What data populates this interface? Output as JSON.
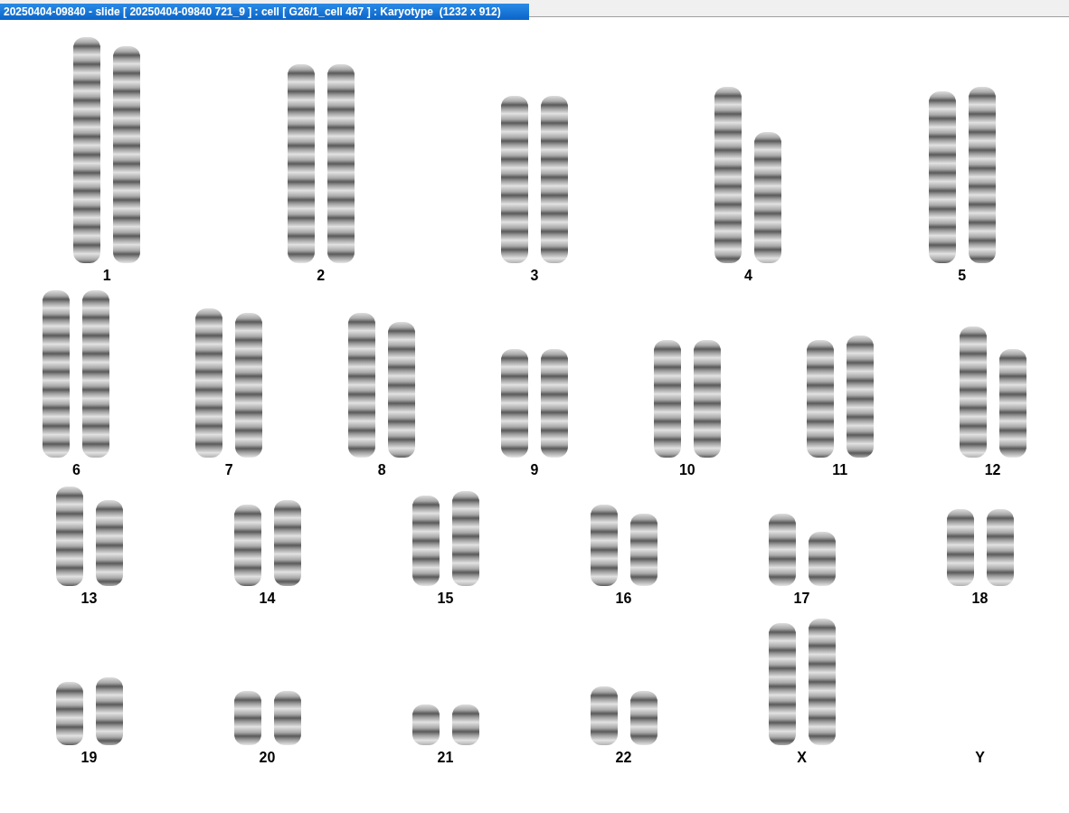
{
  "window": {
    "title": "20250404-09840 - slide [ 20250404-09840 721_9 ] : cell [ G26/1_cell 467 ] : Karyotype  (1232 x 912)"
  },
  "karyotype_rows": [
    {
      "pairs": [
        {
          "label": "1"
        },
        {
          "label": "2"
        },
        {
          "label": "3"
        },
        {
          "label": "4"
        },
        {
          "label": "5"
        }
      ]
    },
    {
      "pairs": [
        {
          "label": "6"
        },
        {
          "label": "7"
        },
        {
          "label": "8"
        },
        {
          "label": "9"
        },
        {
          "label": "10"
        },
        {
          "label": "11"
        },
        {
          "label": "12"
        }
      ]
    },
    {
      "pairs": [
        {
          "label": "13"
        },
        {
          "label": "14"
        },
        {
          "label": "15"
        },
        {
          "label": "16"
        },
        {
          "label": "17"
        },
        {
          "label": "18"
        }
      ]
    },
    {
      "pairs": [
        {
          "label": "19"
        },
        {
          "label": "20"
        },
        {
          "label": "21"
        },
        {
          "label": "22"
        },
        {
          "label": "X"
        },
        {
          "label": "Y"
        }
      ]
    }
  ]
}
